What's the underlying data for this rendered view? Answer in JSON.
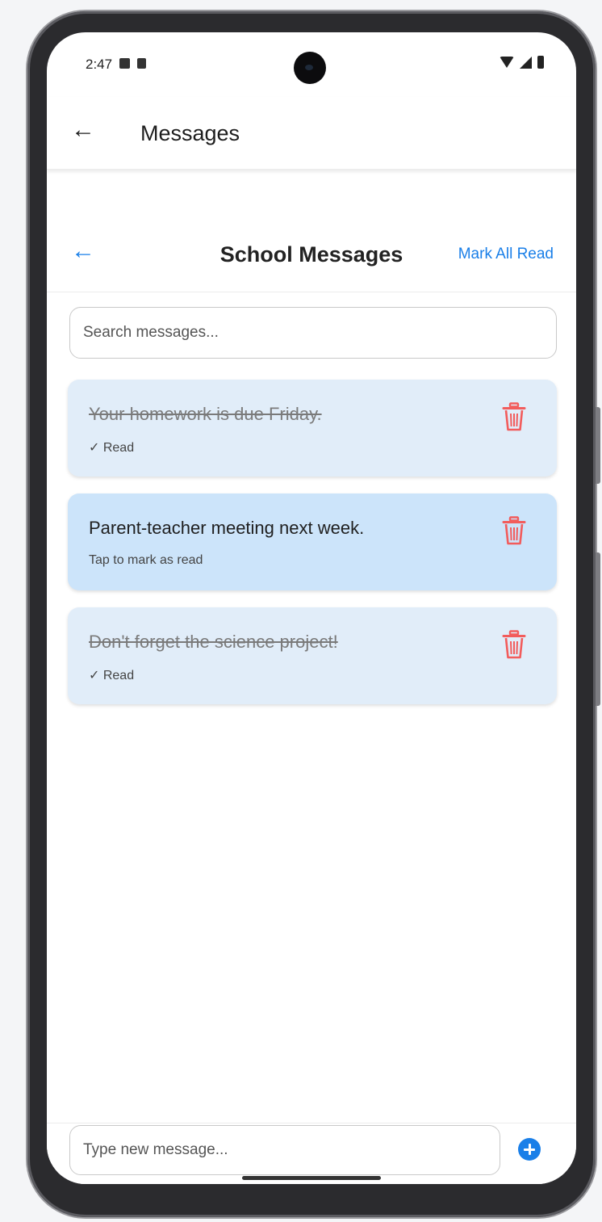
{
  "status_bar": {
    "time": "2:47"
  },
  "app_bar": {
    "title": "Messages"
  },
  "header": {
    "title": "School Messages",
    "mark_all_label": "Mark All Read"
  },
  "search": {
    "placeholder": "Search messages..."
  },
  "messages": [
    {
      "text": "Your homework is due Friday.",
      "status": "✓ Read",
      "read": true
    },
    {
      "text": "Parent-teacher meeting next week.",
      "status": "Tap to mark as read",
      "read": false
    },
    {
      "text": "Don't forget the science project!",
      "status": "✓ Read",
      "read": true
    }
  ],
  "composer": {
    "placeholder": "Type new message..."
  },
  "colors": {
    "accent": "#1a7fe8",
    "delete": "#f25c5c",
    "card_read": "#e1edf9",
    "card_unread": "#cce4fa"
  },
  "icons": {
    "back": "arrow-left-icon",
    "delete": "trash-icon",
    "add": "plus-circle-icon"
  }
}
